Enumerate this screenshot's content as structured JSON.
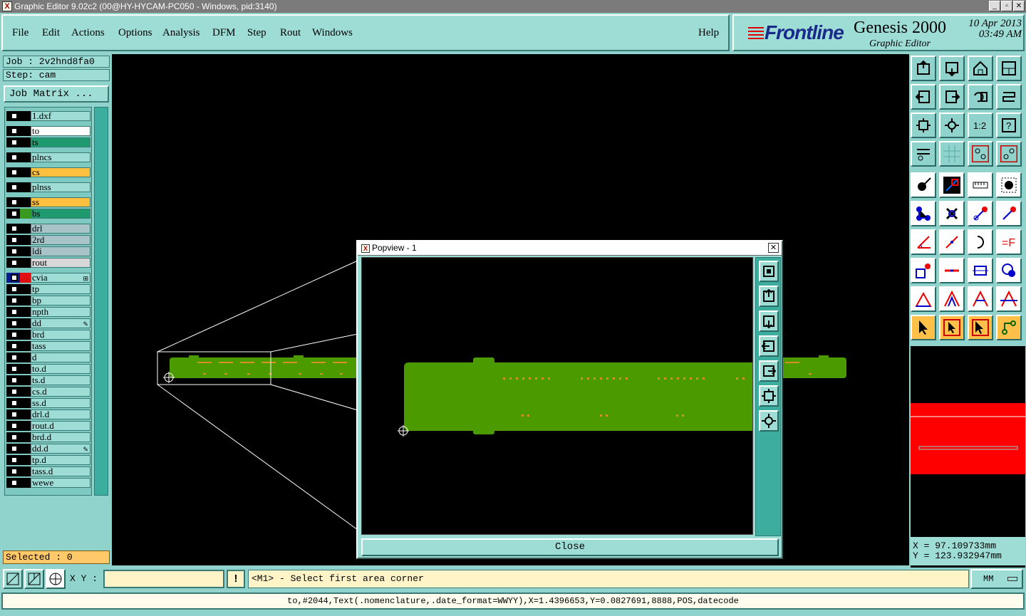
{
  "window": {
    "title": "Graphic Editor 9.02c2 (00@HY-HYCAM-PC050 - Windows, pid:3140)",
    "app_icon": "x-app-icon",
    "controls": [
      "minimize",
      "maximize",
      "close"
    ]
  },
  "menu": {
    "items": [
      "File",
      "Edit",
      "Actions",
      "Options",
      "Analysis",
      "DFM",
      "Step",
      "Rout",
      "Windows"
    ],
    "help": "Help"
  },
  "brand": {
    "logo": "Frontline",
    "product": "Genesis 2000",
    "subtitle": "Graphic Editor",
    "date": "10 Apr 2013",
    "time": "03:49 AM"
  },
  "job": {
    "job_line": "Job : 2v2hnd8fa0",
    "step_line": "Step: cam",
    "matrix_button": "Job Matrix ..."
  },
  "layers": [
    {
      "name": "1.dxf",
      "color": "#9edcd6",
      "mark": ""
    },
    {
      "name": "to",
      "color": "#ffffff",
      "mark": ""
    },
    {
      "name": "ts",
      "color": "#1e9a6e",
      "mark": ""
    },
    {
      "name": "plncs",
      "color": "#9edcd6",
      "mark": ""
    },
    {
      "name": "cs",
      "color": "#ffc040",
      "mark": ""
    },
    {
      "name": "plnss",
      "color": "#9edcd6",
      "mark": ""
    },
    {
      "name": "ss",
      "color": "#ffc040",
      "mark": ""
    },
    {
      "name": "bs",
      "color": "#1e9a6e",
      "mark": "#3a9a20"
    },
    {
      "name": "drl",
      "color": "#a8c4c8",
      "mark": ""
    },
    {
      "name": "2rd",
      "color": "#a8c4c8",
      "mark": ""
    },
    {
      "name": "ldi",
      "color": "#a8c4c8",
      "mark": ""
    },
    {
      "name": "rout",
      "color": "#d8d8d8",
      "mark": ""
    },
    {
      "name": "cvia",
      "color": "#9edcd6",
      "mark": "#e01010",
      "extra": "⊞"
    },
    {
      "name": "tp",
      "color": "#9edcd6",
      "mark": ""
    },
    {
      "name": "bp",
      "color": "#9edcd6",
      "mark": ""
    },
    {
      "name": "npth",
      "color": "#9edcd6",
      "mark": ""
    },
    {
      "name": "dd",
      "color": "#9edcd6",
      "mark": "",
      "extra": "✎"
    },
    {
      "name": "brd",
      "color": "#9edcd6",
      "mark": ""
    },
    {
      "name": "tass",
      "color": "#9edcd6",
      "mark": ""
    },
    {
      "name": "d",
      "color": "#9edcd6",
      "mark": ""
    },
    {
      "name": "to.d",
      "color": "#9edcd6",
      "mark": ""
    },
    {
      "name": "ts.d",
      "color": "#9edcd6",
      "mark": ""
    },
    {
      "name": "cs.d",
      "color": "#9edcd6",
      "mark": ""
    },
    {
      "name": "ss.d",
      "color": "#9edcd6",
      "mark": ""
    },
    {
      "name": "drl.d",
      "color": "#9edcd6",
      "mark": ""
    },
    {
      "name": "rout.d",
      "color": "#9edcd6",
      "mark": ""
    },
    {
      "name": "brd.d",
      "color": "#9edcd6",
      "mark": ""
    },
    {
      "name": "dd.d",
      "color": "#9edcd6",
      "mark": "",
      "extra": "✎"
    },
    {
      "name": "tp.d",
      "color": "#9edcd6",
      "mark": ""
    },
    {
      "name": "tass.d",
      "color": "#9edcd6",
      "mark": ""
    },
    {
      "name": "wewe",
      "color": "#9edcd6",
      "mark": ""
    }
  ],
  "selected": "Selected : 0",
  "toolbar_icons": [
    "zoom-home-icon",
    "zoom-up-icon",
    "home-icon",
    "window-split-icon",
    "pan-left-icon",
    "pan-right-icon",
    "undo-zoom-icon",
    "redraw-icon",
    "fit-frame-icon",
    "fit-all-icon",
    "scale-1-2-icon",
    "help-icon",
    "tools-icon",
    "grid-icon",
    "snap-red-icon",
    "snap-red-2-icon",
    "pick-pad-icon",
    "pick-line-icon",
    "measure-ruler-icon",
    "pad-fill-icon",
    "connect-nodes-icon",
    "cross-mark-icon",
    "point-to-point-icon",
    "edge-arrow-icon",
    "angle-icon",
    "line-icon",
    "arc-icon",
    "text-f-icon",
    "feature-red-icon",
    "split-line-icon",
    "dimension-icon",
    "cluster-icon",
    "triangle-a-icon",
    "triangle-b-icon",
    "triangle-c-icon",
    "triangle-d-icon",
    "select-arrow-icon",
    "select-box-icon",
    "select-orange-icon",
    "select-net-icon"
  ],
  "coords": {
    "x": "X = 97.109733mm",
    "y": "Y = 123.932947mm"
  },
  "command": {
    "xy_label": "X Y :",
    "xy_value": "",
    "excl": "!",
    "prompt": "<M1> - Select first area corner",
    "units": "MM"
  },
  "status": "to,#2044,Text(.nomenclature,.date_format=WWYY),X=1.4396653,Y=0.0827691,8888,POS,datecode",
  "popview": {
    "title": "Popview - 1",
    "close_label": "Close"
  },
  "colors": {
    "board_green": "#4a9a00",
    "pad_orange": "#d89020",
    "panel_teal": "#8fd3cc",
    "minimap_red": "#ff0000"
  }
}
